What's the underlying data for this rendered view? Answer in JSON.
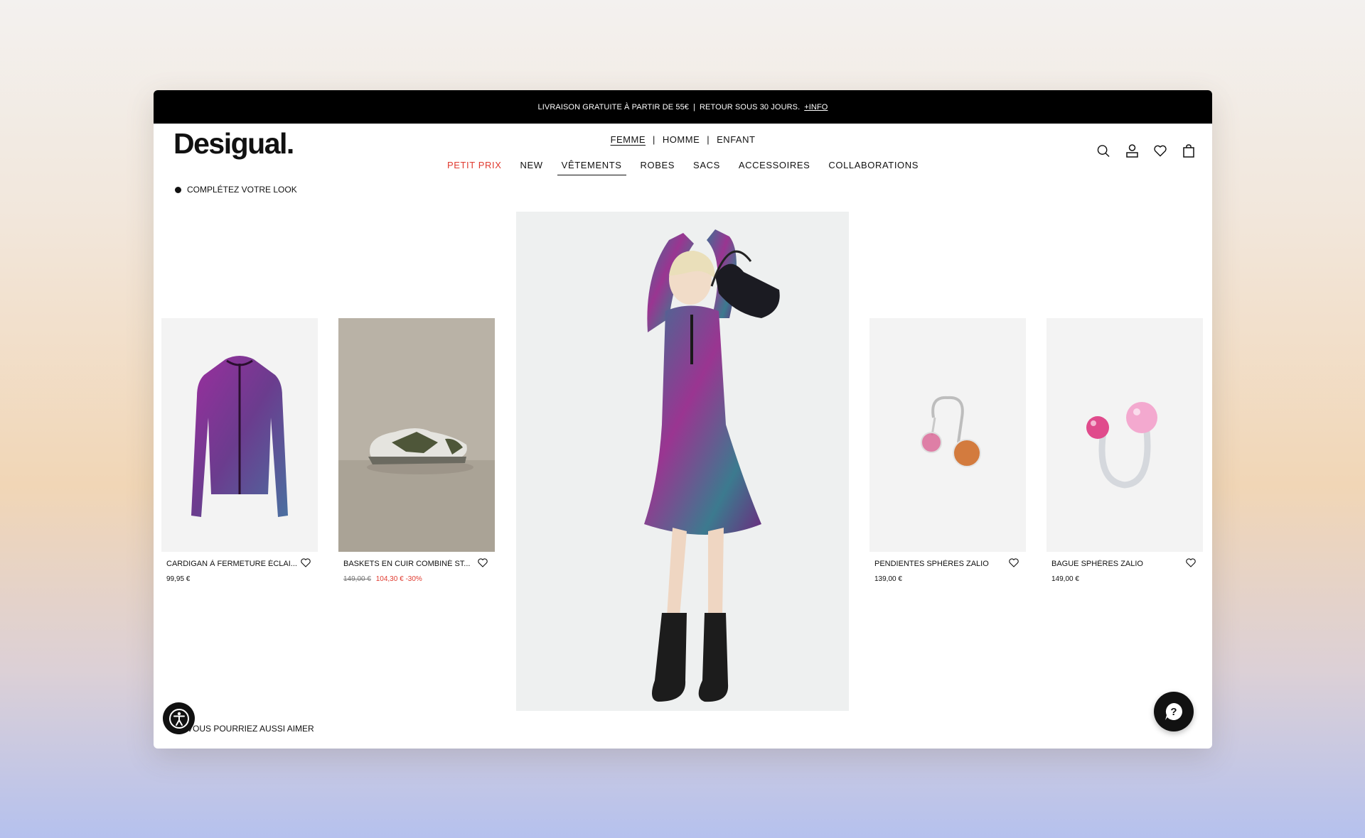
{
  "announcement": {
    "text": "LIVRAISON GRATUITE À PARTIR DE 55€",
    "separator": "|",
    "text2": "RETOUR SOUS 30 JOURS.",
    "link": "+INFO"
  },
  "header": {
    "logo": "Desigual.",
    "gender_tabs": [
      {
        "label": "FEMME",
        "active": true
      },
      {
        "label": "HOMME"
      },
      {
        "label": "ENFANT"
      }
    ],
    "gender_separator": "|",
    "categories": [
      {
        "label": "PETIT PRIX",
        "highlight": true
      },
      {
        "label": "NEW"
      },
      {
        "label": "VÊTEMENTS",
        "active": true
      },
      {
        "label": "ROBES"
      },
      {
        "label": "SACS"
      },
      {
        "label": "ACCESSOIRES"
      },
      {
        "label": "COLLABORATIONS"
      }
    ],
    "icons": [
      "search-icon",
      "user-icon",
      "heart-icon",
      "bag-icon"
    ]
  },
  "complete_look": {
    "label": "COMPLÉTEZ VOTRE LOOK"
  },
  "products": [
    {
      "name": "CARDIGAN À FERMETURE ÉCLAI...",
      "price": "99,95 €"
    },
    {
      "name": "BASKETS EN CUIR COMBINÉ ST...",
      "old_price": "149,00 €",
      "price": "104,30 €",
      "discount": "-30%"
    },
    {
      "name": "PENDIENTES SPHÈRES ZALIO",
      "price": "139,00 €"
    },
    {
      "name": "BAGUE SPHÈRES ZALIO",
      "price": "149,00 €"
    }
  ],
  "also_like": {
    "label": "VOUS POURRIEZ AUSSI AIMER"
  },
  "colors": {
    "accent_red": "#e03a2f",
    "black": "#111111"
  }
}
